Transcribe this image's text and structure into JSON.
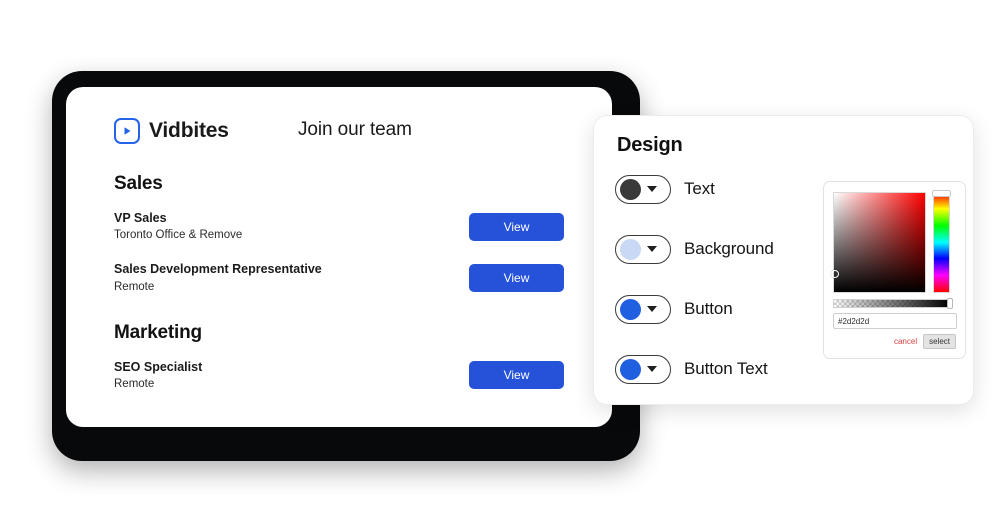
{
  "site": {
    "brand": {
      "name": "Vidbites",
      "logo_icon": "play-square-icon",
      "logo_color": "#2563eb"
    },
    "header_title": "Join our team",
    "departments": [
      {
        "name": "Sales",
        "jobs": [
          {
            "title": "VP Sales",
            "location": "Toronto Office & Remove",
            "action": "View"
          },
          {
            "title": "Sales Development Representative",
            "location": "Remote",
            "action": "View"
          }
        ]
      },
      {
        "name": "Marketing",
        "jobs": [
          {
            "title": "SEO Specialist",
            "location": "Remote",
            "action": "View"
          }
        ]
      }
    ]
  },
  "design_panel": {
    "title": "Design",
    "swatches": [
      {
        "label": "Text",
        "color": "#3a3a3a",
        "caret_icon": "chevron-down-icon"
      },
      {
        "label": "Background",
        "color": "#c8d8f5",
        "caret_icon": "chevron-down-icon"
      },
      {
        "label": "Button",
        "color": "#1f5fe0",
        "caret_icon": "chevron-down-icon"
      },
      {
        "label": "Button Text",
        "color": "#1f5fe0",
        "caret_icon": "chevron-down-icon"
      }
    ],
    "color_picker": {
      "hex_value": "#2d2d2d",
      "hex_placeholder": "#000000",
      "cancel_label": "cancel",
      "select_label": "select"
    }
  },
  "theme": {
    "button_blue": "#2552d8",
    "accent_blue": "#2563eb",
    "text_dark": "#1a1a1a",
    "cancel_red": "#d94242"
  }
}
